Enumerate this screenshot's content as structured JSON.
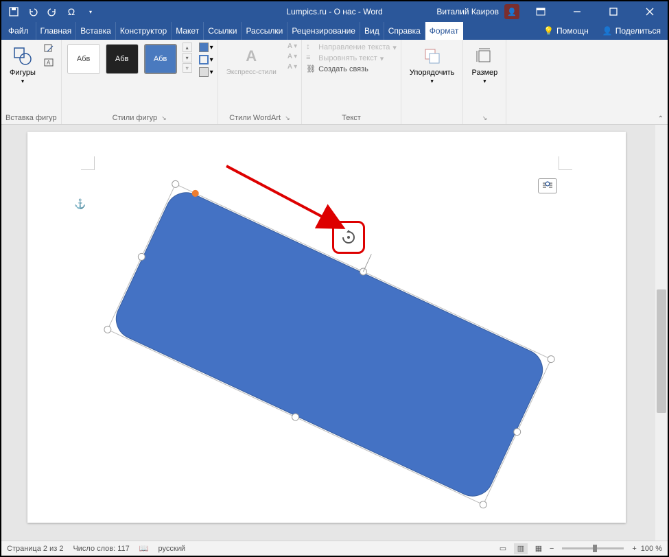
{
  "title": "Lumpics.ru - О нас  -  Word",
  "user": "Виталий Каиров",
  "menu": {
    "file": "Файл",
    "home": "Главная",
    "insert": "Вставка",
    "design": "Конструктор",
    "layout": "Макет",
    "references": "Ссылки",
    "mailings": "Рассылки",
    "review": "Рецензирование",
    "view": "Вид",
    "help": "Справка",
    "format": "Формат",
    "assist": "Помощн",
    "share": "Поделиться"
  },
  "ribbon": {
    "shapes_btn": "Фигуры",
    "insert_shapes": "Вставка фигур",
    "style_sample": "Абв",
    "shape_styles": "Стили фигур",
    "wordart_btn": "Экспресс-стили",
    "wordart_styles": "Стили WordArt",
    "text_direction": "Направление текста",
    "align_text": "Выровнять текст",
    "create_link": "Создать связь",
    "text_group": "Текст",
    "arrange": "Упорядочить",
    "size": "Размер"
  },
  "status": {
    "page": "Страница 2 из 2",
    "words": "Число слов: 117",
    "lang": "русский",
    "zoom_minus": "−",
    "zoom_plus": "+",
    "zoom": "100 %"
  }
}
